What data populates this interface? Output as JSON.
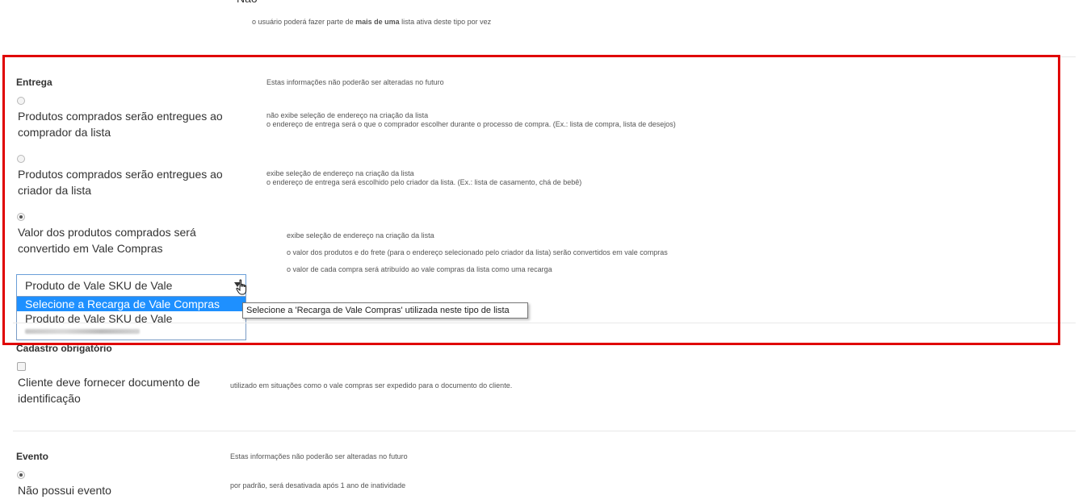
{
  "top": {
    "cut_label": "Não",
    "note_prefix": "o usuário poderá fazer parte de ",
    "note_bold": "mais de uma",
    "note_suffix": " lista ativa deste tipo por vez"
  },
  "entrega": {
    "title": "Entrega",
    "info": "Estas informações não poderão ser alteradas no futuro",
    "options": [
      {
        "label": "Produtos comprados serão entregues ao comprador da lista",
        "desc": [
          "não exibe seleção de endereço na criação da lista",
          "o endereço de entrega será o que o comprador escolher durante o processo de compra. (Ex.: lista de compra, lista de desejos)"
        ],
        "checked": false
      },
      {
        "label": "Produtos comprados serão entregues ao criador da lista",
        "desc": [
          "exibe seleção de endereço na criação da lista",
          "o endereço de entrega será escolhido pelo criador da lista. (Ex.: lista de casamento, chá de bebê)"
        ],
        "checked": false
      },
      {
        "label": "Valor dos produtos comprados será convertido em Vale Compras",
        "desc": [
          "exibe seleção de endereço na criação da lista",
          "o valor dos produtos e do frete (para o endereço selecionado pelo criador da lista) serão convertidos em vale compras",
          "o valor de cada compra será atribuído ao vale compras da lista como uma recarga"
        ],
        "checked": true
      }
    ],
    "select": {
      "value": "Produto de Vale SKU de Vale",
      "options": [
        "Selecione a Recarga de Vale Compras",
        "Produto de Vale SKU de Vale"
      ],
      "highlighted_index": 0
    },
    "tooltip": "Selecione a 'Recarga de Vale Compras' utilizada neste tipo de lista"
  },
  "cadastro": {
    "title": "Cadastro obrigatório",
    "checkbox_label": "Cliente deve fornecer documento de identificação",
    "desc": "utilizado em situações como o vale compras ser expedido para o documento do cliente."
  },
  "evento": {
    "title": "Evento",
    "info": "Estas informações não poderão ser alteradas no futuro",
    "option_label": "Não possui evento",
    "desc": "por padrão, será desativada após 1 ano de inatividade",
    "checked": true
  },
  "colors": {
    "highlight": "#e00000",
    "selected_option": "#1e90ff",
    "select_border": "#6a9fd8"
  }
}
